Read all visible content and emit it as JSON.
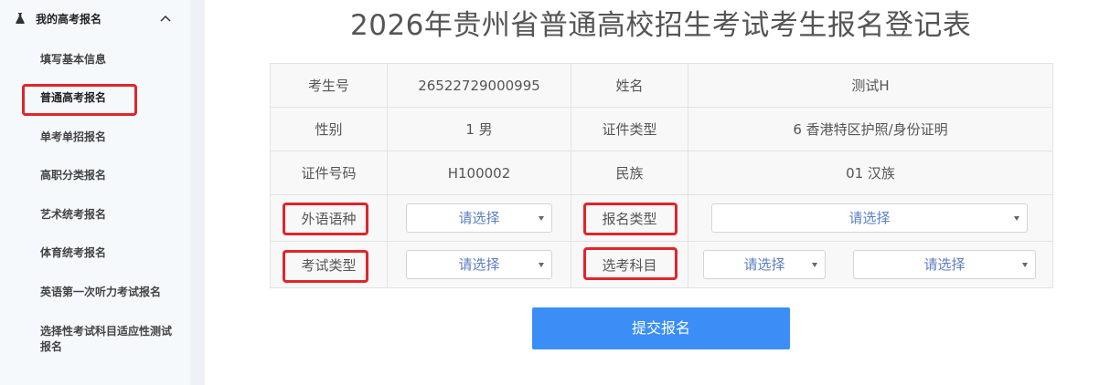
{
  "sidebar": {
    "header_title": "我的高考报名",
    "items": [
      {
        "label": "填写基本信息"
      },
      {
        "label": "普通高考报名"
      },
      {
        "label": "单考单招报名"
      },
      {
        "label": "高职分类报名"
      },
      {
        "label": "艺术统考报名"
      },
      {
        "label": "体育统考报名"
      },
      {
        "label": "英语第一次听力考试报名"
      },
      {
        "label": "选择性考试科目适应性测试报名"
      }
    ]
  },
  "page": {
    "title": "2026年贵州省普通高校招生考试考生报名登记表"
  },
  "form": {
    "exam_no_label": "考生号",
    "exam_no": "26522729000995",
    "name_label": "姓名",
    "name": "测试H",
    "gender_label": "性别",
    "gender": "1 男",
    "id_type_label": "证件类型",
    "id_type": "6 香港特区护照/身份证明",
    "id_no_label": "证件号码",
    "id_no": "H100002",
    "ethnicity_label": "民族",
    "ethnicity": "01 汉族",
    "language_label": "外语语种",
    "language_value": "请选择",
    "reg_type_label": "报名类型",
    "reg_type_value": "请选择",
    "exam_type_label": "考试类型",
    "exam_type_value": "请选择",
    "subject_label": "选考科目",
    "subject_value_1": "请选择",
    "subject_value_2": "请选择"
  },
  "submit_label": "提交报名",
  "colors": {
    "accent": "#3b8ef5",
    "highlight": "#e0252b",
    "select_text": "#5b7fc2"
  }
}
